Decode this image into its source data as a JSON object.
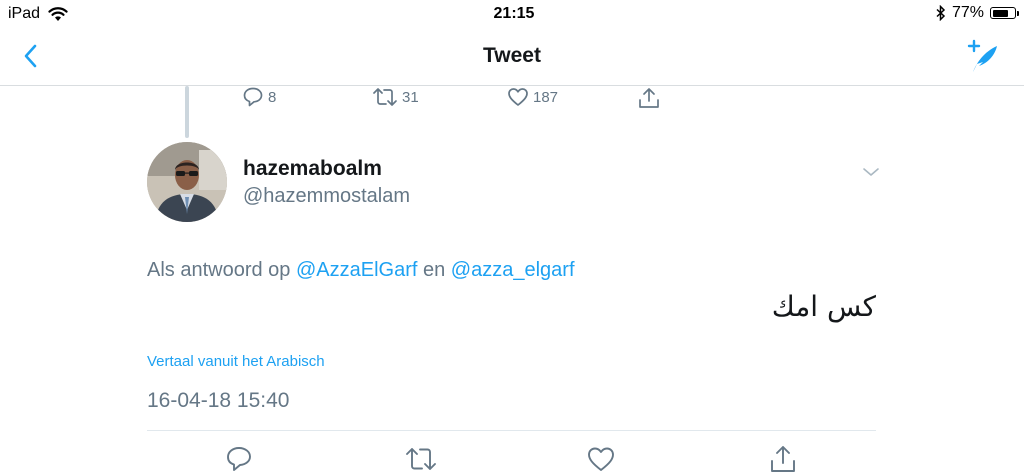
{
  "status_bar": {
    "device": "iPad",
    "time": "21:15",
    "battery_percent": "77%",
    "battery_level": 0.77
  },
  "nav": {
    "title": "Tweet"
  },
  "previous_tweet": {
    "reply_count": "8",
    "retweet_count": "31",
    "like_count": "187"
  },
  "tweet": {
    "display_name": "hazemaboalm",
    "handle": "@hazemmostalam",
    "reply_prefix": "Als antwoord op ",
    "mention_1": "@AzzaElGarf",
    "reply_joiner": " en ",
    "mention_2": "@azza_elgarf",
    "text": "كس امك",
    "translate_label": "Vertaal vanuit het Arabisch",
    "timestamp": "16-04-18 15:40"
  },
  "colors": {
    "accent": "#1da1f2",
    "secondary_text": "#657786",
    "primary_text": "#14171a"
  }
}
